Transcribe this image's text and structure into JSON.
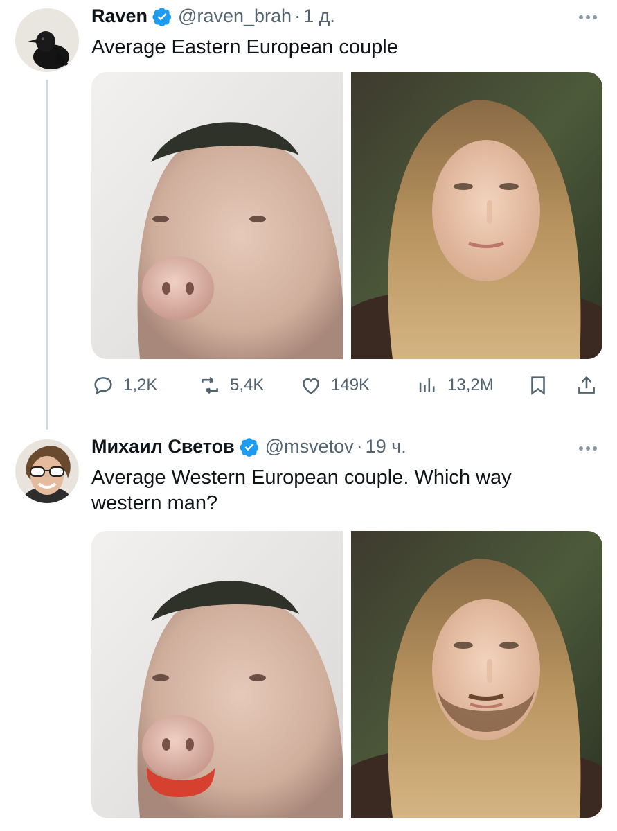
{
  "tweets": [
    {
      "author_name": "Raven",
      "handle": "@raven_brah",
      "separator": "·",
      "time": "1 д.",
      "text": "Average Eastern European couple",
      "stats": {
        "replies": "1,2K",
        "retweets": "5,4K",
        "likes": "149K",
        "views": "13,2M"
      }
    },
    {
      "author_name": "Михаил Светов",
      "handle": "@msvetov",
      "separator": "·",
      "time": "19 ч.",
      "text": "Average Western European couple. Which way western man?"
    }
  ],
  "colors": {
    "verified": "#1d9bf0",
    "secondary_text": "#536471",
    "thread_line": "#cfd9de"
  },
  "icons": [
    "verified-badge-icon",
    "more-icon",
    "reply-icon",
    "retweet-icon",
    "like-icon",
    "views-icon",
    "bookmark-icon",
    "share-icon"
  ]
}
